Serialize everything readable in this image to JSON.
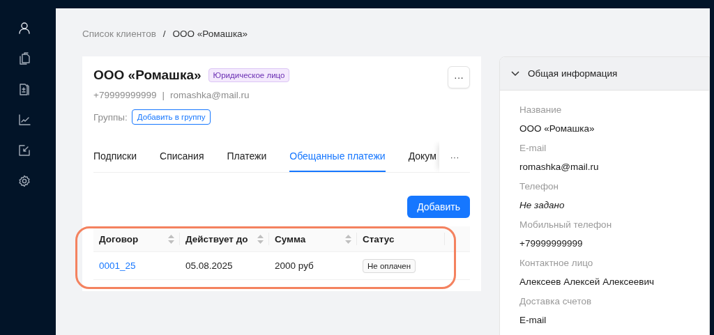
{
  "sidebar": {
    "items": [
      {
        "selected": true
      },
      {
        "selected": false
      },
      {
        "selected": false
      },
      {
        "selected": false
      },
      {
        "selected": false
      },
      {
        "selected": false
      }
    ]
  },
  "breadcrumb": {
    "separator": "/",
    "items": [
      {
        "label": "Список клиентов",
        "current": false
      },
      {
        "label": "ООО «Ромашка»",
        "current": true
      }
    ]
  },
  "client": {
    "name": "ООО «Ромашка»",
    "type_badge": "Юридическое лицо",
    "phone": "+79999999999",
    "contact_separator": "|",
    "email": "romashka@mail.ru",
    "groups_label": "Группы:",
    "add_group_button": "Добавить в группу",
    "more_button": "···"
  },
  "tabs": [
    {
      "label": "Подписки",
      "selected": false
    },
    {
      "label": "Списания",
      "selected": false
    },
    {
      "label": "Платежи",
      "selected": false
    },
    {
      "label": "Обещанные платежи",
      "selected": true
    },
    {
      "label": "Докум",
      "selected": false
    }
  ],
  "tabs_more": "···",
  "add_button": "Добавить",
  "table": {
    "columns": [
      {
        "label": "Договор",
        "sortable": true
      },
      {
        "label": "Действует до",
        "sortable": true
      },
      {
        "label": "Сумма",
        "sortable": true
      },
      {
        "label": "Статус",
        "sortable": false
      }
    ],
    "rows": [
      {
        "contract": "0001_25",
        "valid_until": "05.08.2025",
        "amount": "2000 руб",
        "status": "Не оплачен"
      }
    ],
    "highlighted": true
  },
  "info_panel": {
    "title": "Общая информация",
    "expanded": true,
    "fields": [
      {
        "label": "Название",
        "value": "ООО «Ромашка»",
        "missing": false
      },
      {
        "label": "E-mail",
        "value": "romashka@mail.ru",
        "missing": false
      },
      {
        "label": "Телефон",
        "value": "Не задано",
        "missing": true
      },
      {
        "label": "Мобильный телефон",
        "value": "+79999999999",
        "missing": false
      },
      {
        "label": "Контактное лицо",
        "value": "Алексеев Алексей Алексеевич",
        "missing": false
      },
      {
        "label": "Доставка счетов",
        "value": "E-mail",
        "missing": false
      }
    ]
  }
}
